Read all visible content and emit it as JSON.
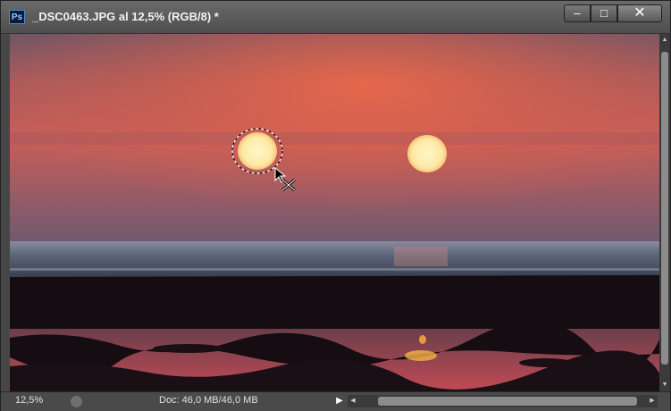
{
  "window": {
    "app_icon_label": "Ps",
    "title": "_DSC0463.JPG al 12,5% (RGB/8) *",
    "buttons": {
      "minimize": "‒",
      "maximize": "□",
      "close": "✕"
    }
  },
  "status": {
    "zoom": "12,5%",
    "doc_info": "Doc: 46,0 MB/46,0 MB",
    "menu_arrow": "▶"
  },
  "icons": {
    "app": "photoshop-icon",
    "cursor": "move-selection-cursor-icon"
  },
  "colors": {
    "sky_top": "#6e5566",
    "sky_mid": "#e0614a",
    "sea": "#5a6578",
    "sun": "#fff2b8"
  }
}
